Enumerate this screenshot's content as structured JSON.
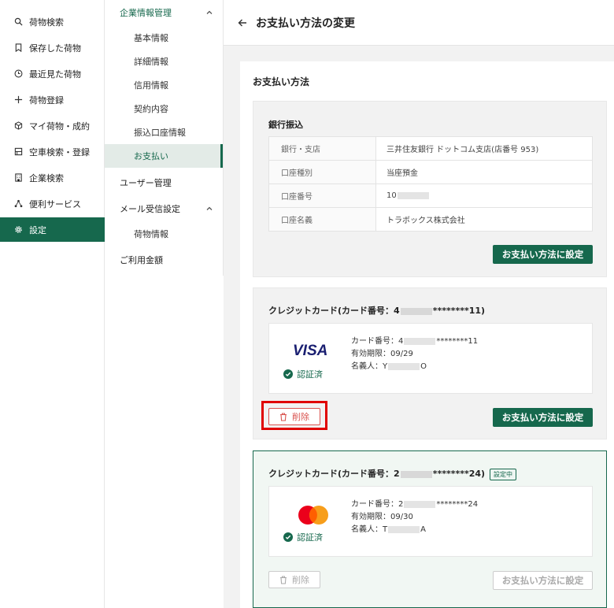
{
  "nav": {
    "items": [
      {
        "icon": "search-icon",
        "label": "荷物検索"
      },
      {
        "icon": "bookmark-icon",
        "label": "保存した荷物"
      },
      {
        "icon": "clock-icon",
        "label": "最近見た荷物"
      },
      {
        "icon": "plus-icon",
        "label": "荷物登録"
      },
      {
        "icon": "box-icon",
        "label": "マイ荷物・成約"
      },
      {
        "icon": "truck-icon",
        "label": "空車検索・登録"
      },
      {
        "icon": "building-icon",
        "label": "企業検索"
      },
      {
        "icon": "network-icon",
        "label": "便利サービス"
      },
      {
        "icon": "gear-icon",
        "label": "設定"
      }
    ]
  },
  "subnav": {
    "company_header": "企業情報管理",
    "company_items": [
      "基本情報",
      "詳細情報",
      "信用情報",
      "契約内容",
      "振込口座情報",
      "お支払い"
    ],
    "user_mgmt": "ユーザー管理",
    "mail_header": "メール受信設定",
    "mail_items": [
      "荷物情報"
    ],
    "usage": "ご利用金額"
  },
  "header": {
    "title": "お支払い方法の変更"
  },
  "panel": {
    "title": "お支払い方法"
  },
  "bank": {
    "title": "銀行振込",
    "rows": [
      {
        "k": "銀行・支店",
        "v": "三井住友銀行 ドットコム支店(店番号 953)"
      },
      {
        "k": "口座種別",
        "v": "当座預金"
      },
      {
        "k": "口座番号",
        "v": "10"
      },
      {
        "k": "口座名義",
        "v": "トラボックス株式会社"
      }
    ],
    "set_button": "お支払い方法に設定"
  },
  "card1": {
    "title_prefix": "クレジットカード(カード番号：4",
    "title_suffix": "********11)",
    "brand": "VISA",
    "verified": "認証済",
    "number_prefix": "カード番号：4",
    "number_suffix": "********11",
    "expiry": "有効期限：09/29",
    "holder_prefix": "名義人：Y",
    "holder_suffix": "O",
    "delete_button": "削除",
    "set_button": "お支払い方法に設定"
  },
  "card2": {
    "title_prefix": "クレジットカード(カード番号：2",
    "title_suffix": "********24)",
    "badge": "設定中",
    "verified": "認証済",
    "number_prefix": "カード番号：2",
    "number_suffix": "********24",
    "expiry": "有効期限：09/30",
    "holder_prefix": "名義人：T",
    "holder_suffix": "A",
    "delete_button": "削除",
    "set_button": "お支払い方法に設定"
  },
  "colors": {
    "accent": "#16684d",
    "danger": "#d9534f",
    "highlight": "#e00000"
  }
}
